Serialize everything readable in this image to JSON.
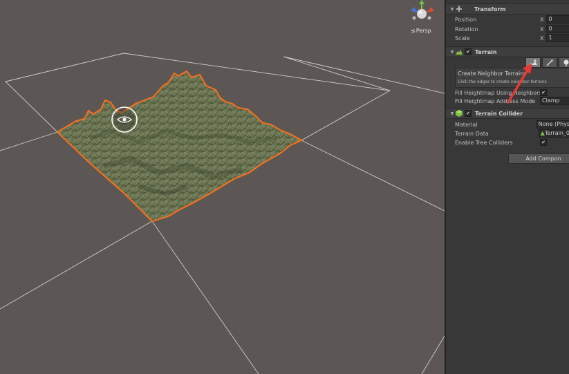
{
  "scene": {
    "view_mode_label": "Persp",
    "colors": {
      "background": "#5c5654",
      "grid_line": "#e8e4e0",
      "selection_outline": "#f07020"
    }
  },
  "inspector": {
    "transform": {
      "title": "Transform",
      "rows": [
        {
          "label": "Position",
          "axis": "X",
          "value": "0"
        },
        {
          "label": "Rotation",
          "axis": "X",
          "value": "0"
        },
        {
          "label": "Scale",
          "axis": "X",
          "value": "1"
        }
      ]
    },
    "terrain": {
      "title": "Terrain",
      "enabled": "✔",
      "tools": [
        "create-neighbor-terrain-tool-icon",
        "paint-terrain-tool-icon",
        "paint-trees-tool-icon"
      ],
      "neighbor_title": "Create Neighbor Terrains",
      "neighbor_hint": "Click the edges to create neighbor terrains",
      "fill_heightmap_label": "Fill Heightmap Using Neighbors",
      "fill_heightmap_checked": "✔",
      "address_mode_label": "Fill Heightmap Address Mode",
      "address_mode_value": "Clamp"
    },
    "collider": {
      "title": "Terrain Collider",
      "enabled": "✔",
      "material_label": "Material",
      "material_value": "None (Phys",
      "terrain_data_label": "Terrain Data",
      "terrain_data_value": "Terrain_0",
      "tree_colliders_label": "Enable Tree Colliders",
      "tree_colliders_checked": "✔"
    },
    "add_component_label": "Add Compon"
  },
  "colors": {
    "annotation_arrow": "#e53935",
    "inspector_bg": "#383838"
  }
}
